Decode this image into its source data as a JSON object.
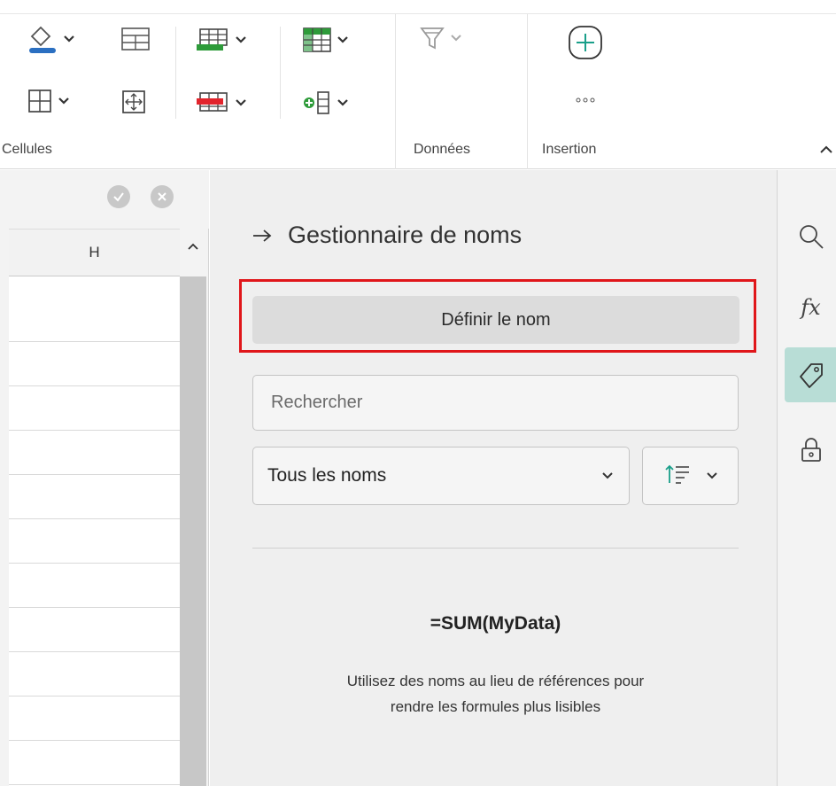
{
  "ribbon": {
    "groups": {
      "cells_label": "Cellules",
      "data_label": "Données",
      "insert_label": "Insertion"
    },
    "icons": {
      "fill": "fill-color-icon",
      "cell_style": "cell-style-icon",
      "borders": "borders-icon",
      "merge": "merge-cells-icon",
      "insert_rows": "insert-rows-icon",
      "delete_rows": "delete-rows-icon",
      "format_table": "format-as-table-icon",
      "insert_columns": "insert-columns-icon",
      "filter": "filter-icon",
      "add_object": "add-object-icon",
      "more": "more-icon",
      "collapse": "collapse-ribbon-icon"
    },
    "more_label": "···"
  },
  "sheet": {
    "column_header": "H",
    "confirm_icon": "check-icon",
    "cancel_icon": "close-icon"
  },
  "panel": {
    "title": "Gestionnaire de noms",
    "back_icon": "arrow-right-icon",
    "define_button": "Définir le nom",
    "search_placeholder": "Rechercher",
    "search_value": "",
    "filter_select": "Tous les noms",
    "sort_icon": "sort-icon",
    "example_formula": "=SUM(MyData)",
    "hint_line1": "Utilisez des noms au lieu de références pour",
    "hint_line2": "rendre les formules plus lisibles"
  },
  "sidebar": {
    "items": [
      {
        "icon": "search-icon",
        "active": false
      },
      {
        "icon": "function-icon",
        "label": "fx",
        "active": false
      },
      {
        "icon": "tag-icon",
        "active": true
      },
      {
        "icon": "lock-icon",
        "active": false
      }
    ]
  },
  "colors": {
    "accent_teal": "#1a9f8a",
    "active_sidebar": "#b8ddd6",
    "highlight_red": "#e0161a",
    "insert_green": "#2e9b3a",
    "delete_red": "#e2242c",
    "fill_blue": "#2b6fc1"
  }
}
